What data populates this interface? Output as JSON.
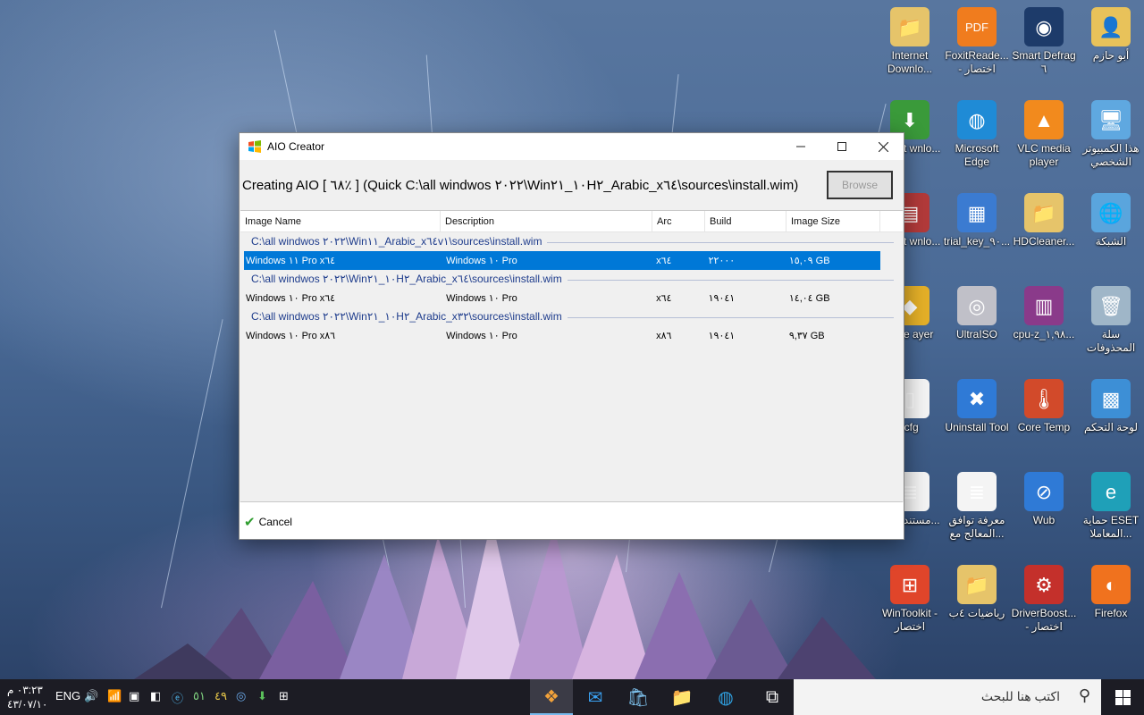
{
  "dialog": {
    "title": "AIO Creator",
    "status": "Creating AIO [ ٦٨٪ ] (Quick C:\\all windwos ٢٠٢٢\\Win١٠_٢١H٢_Arabic_x٦٤\\sources\\install.wim)",
    "browse_label": "Browse",
    "cancel_label": "Cancel",
    "columns": [
      "Image Name",
      "Description",
      "Arc",
      "Build",
      "Image Size"
    ],
    "groups": [
      {
        "path": "C:\\all windwos ٢٠٢٢\\Win١١_Arabic_x٦٤v١\\sources\\install.wim",
        "items": [
          {
            "name": "Windows ١١ Pro x٦٤",
            "description": "Windows ١٠ Pro",
            "arc": "x٦٤",
            "build": "٢٢٠٠٠",
            "size": "١٥,٠٩ GB",
            "selected": true
          }
        ]
      },
      {
        "path": "C:\\all windwos ٢٠٢٢\\Win١٠_٢١H٢_Arabic_x٦٤\\sources\\install.wim",
        "items": [
          {
            "name": "Windows ١٠ Pro x٦٤",
            "description": "Windows ١٠ Pro",
            "arc": "x٦٤",
            "build": "١٩٠٤١",
            "size": "١٤,٠٤ GB",
            "selected": false
          }
        ]
      },
      {
        "path": "C:\\all windwos ٢٠٢٢\\Win١٠_٢١H٢_Arabic_x٣٢\\sources\\install.wim",
        "items": [
          {
            "name": "Windows ١٠ Pro x٨٦",
            "description": "Windows ١٠ Pro",
            "arc": "x٨٦",
            "build": "١٩٠٤١",
            "size": "٩,٣٧ GB",
            "selected": false
          }
        ]
      }
    ]
  },
  "desktop_icons": [
    {
      "label": "أبو حازم",
      "icon": "user-folder-icon",
      "color": "#e8c25a"
    },
    {
      "label": "Smart Defrag ٦",
      "icon": "defrag-icon",
      "color": "#1d3b6a"
    },
    {
      "label": "FoxitReade... - اختصار",
      "icon": "pdf-icon",
      "color": "#f07c1e"
    },
    {
      "label": "Internet Downlo...",
      "icon": "folder-icon",
      "color": "#e6c46a"
    },
    {
      "label": "هذا الكمبيوتر الشخصي",
      "icon": "computer-icon",
      "color": "#5fa8e0"
    },
    {
      "label": "VLC media player",
      "icon": "vlc-icon",
      "color": "#f28a1d"
    },
    {
      "label": "Microsoft Edge",
      "icon": "edge-icon",
      "color": "#1f8bd6"
    },
    {
      "label": "ternet wnlo...",
      "icon": "idm-icon",
      "color": "#3a9a3a"
    },
    {
      "label": "الشبكة",
      "icon": "network-icon",
      "color": "#5aa5dd"
    },
    {
      "label": "HDCleaner...",
      "icon": "folder-icon",
      "color": "#e6c46a"
    },
    {
      "label": "trial_key_٩٠...",
      "icon": "registry-icon",
      "color": "#3b7bd1"
    },
    {
      "label": "ternet wnlo...",
      "icon": "archive-icon",
      "color": "#b33a3a"
    },
    {
      "label": "سلة المحذوفات",
      "icon": "recycle-bin-icon",
      "color": "#9fb6c8"
    },
    {
      "label": "cpu-z_١,٩٨...",
      "icon": "winrar-icon",
      "color": "#8a3a8a"
    },
    {
      "label": "UltraISO",
      "icon": "disc-icon",
      "color": "#c0c0c8"
    },
    {
      "label": "ware ayer",
      "icon": "vmware-icon",
      "color": "#e5b028"
    },
    {
      "label": "لوحة التحكم",
      "icon": "control-panel-icon",
      "color": "#3d8fd6"
    },
    {
      "label": "Core Temp",
      "icon": "thermometer-icon",
      "color": "#d24a2a"
    },
    {
      "label": "Uninstall Tool",
      "icon": "uninstall-icon",
      "color": "#2f7ad6"
    },
    {
      "label": ".cfg",
      "icon": "file-icon",
      "color": "#f4f4f4"
    },
    {
      "label": "حماية ESET المعاملا...",
      "icon": "eset-icon",
      "color": "#1fa0b8"
    },
    {
      "label": "Wub",
      "icon": "wub-icon",
      "color": "#2f7ad6"
    },
    {
      "label": "معرفة توافق المعالج مع...",
      "icon": "text-file-icon",
      "color": "#f4f4f4"
    },
    {
      "label": "مستند جدي...",
      "icon": "text-file-icon",
      "color": "#f4f4f4"
    },
    {
      "label": "Firefox",
      "icon": "firefox-icon",
      "color": "#f0721e"
    },
    {
      "label": "DriverBoost... - اختصار",
      "icon": "driverbooster-icon",
      "color": "#c4302b"
    },
    {
      "label": "رياضيات ٤ب",
      "icon": "folder-icon",
      "color": "#e6c46a"
    },
    {
      "label": "WinToolkit - اختصار",
      "icon": "windows-flag-icon",
      "color": "#e0452a"
    }
  ],
  "taskbar": {
    "clock_time": "٠٣:٢٣ م",
    "clock_date": "٤٣/٠٧/١٠",
    "lang": "ENG",
    "search_placeholder": "اكتب هنا للبحث",
    "tray_number_1": "٥١",
    "tray_number_2": "٤٩"
  }
}
